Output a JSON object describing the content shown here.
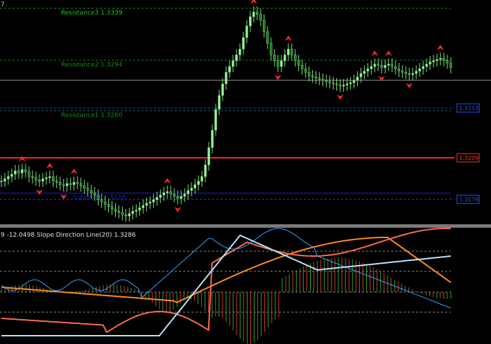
{
  "main_panel": {
    "corner_mark": "7",
    "resistance_labels": [
      {
        "text": "Resistance3 1.3339",
        "color": "#21c521"
      },
      {
        "text": "Resistance2 1.3294",
        "color": "#1a8a1a"
      },
      {
        "text": "Resistance1 1.3260",
        "color": "#1a8a1a"
      }
    ],
    "support_label": {
      "text": "Support1 1.3178",
      "color": "#1a1acc"
    },
    "price_tags": [
      {
        "text": "1.3253",
        "color": "#2a50ff",
        "fill": "#000000"
      },
      {
        "text": "1.3209",
        "color": "#ff3030",
        "fill": "#000000"
      },
      {
        "text": "1.3179",
        "color": "#2a50ff",
        "fill": "#000000"
      }
    ]
  },
  "indicator_panel": {
    "title": "9 -12.0498   Slope Direction Line(20) 1.3286"
  },
  "chart_data": {
    "type": "candlestick",
    "price_close": [
      1.3196,
      1.3198,
      1.32,
      1.3202,
      1.3205,
      1.3203,
      1.3206,
      1.3204,
      1.32,
      1.3199,
      1.3197,
      1.3196,
      1.3198,
      1.3199,
      1.32,
      1.3196,
      1.3195,
      1.3193,
      1.3192,
      1.3194,
      1.3193,
      1.3195,
      1.3194,
      1.3192,
      1.319,
      1.3188,
      1.3186,
      1.3184,
      1.318,
      1.3178,
      1.3176,
      1.3174,
      1.3172,
      1.317,
      1.3169,
      1.3167,
      1.3166,
      1.3168,
      1.317,
      1.3171,
      1.3173,
      1.3175,
      1.3177,
      1.3178,
      1.318,
      1.3182,
      1.3184,
      1.3186,
      1.3187,
      1.3185,
      1.3183,
      1.3181,
      1.3183,
      1.3185,
      1.3188,
      1.319,
      1.3193,
      1.3196,
      1.32,
      1.321,
      1.3225,
      1.324,
      1.3258,
      1.327,
      1.328,
      1.329,
      1.3295,
      1.33,
      1.3305,
      1.331,
      1.332,
      1.333,
      1.3338,
      1.3342,
      1.334,
      1.3335,
      1.3325,
      1.3315,
      1.3305,
      1.33,
      1.3295,
      1.33,
      1.3305,
      1.331,
      1.3305,
      1.33,
      1.3296,
      1.3293,
      1.329,
      1.3287,
      1.3286,
      1.3285,
      1.3284,
      1.3283,
      1.3282,
      1.3281,
      1.328,
      1.3279,
      1.3278,
      1.3279,
      1.328,
      1.3281,
      1.3283,
      1.3286,
      1.3289,
      1.3291,
      1.3293,
      1.3295,
      1.3297,
      1.3296,
      1.3294,
      1.3296,
      1.3297,
      1.3295,
      1.3293,
      1.3291,
      1.329,
      1.3289,
      1.3288,
      1.3289,
      1.3291,
      1.3293,
      1.3295,
      1.3297,
      1.3299,
      1.33,
      1.3301,
      1.3302,
      1.33,
      1.3298,
      1.3294
    ],
    "levels": {
      "resistance3": 1.3339,
      "resistance2": 1.3294,
      "resistance1": 1.326,
      "pivot_grey": 1.3284,
      "red": 1.3209,
      "blue_upper": 1.3253,
      "blue_lower": 1.3179,
      "support1": 1.3178
    },
    "price_ylim": [
      1.316,
      1.335
    ]
  }
}
